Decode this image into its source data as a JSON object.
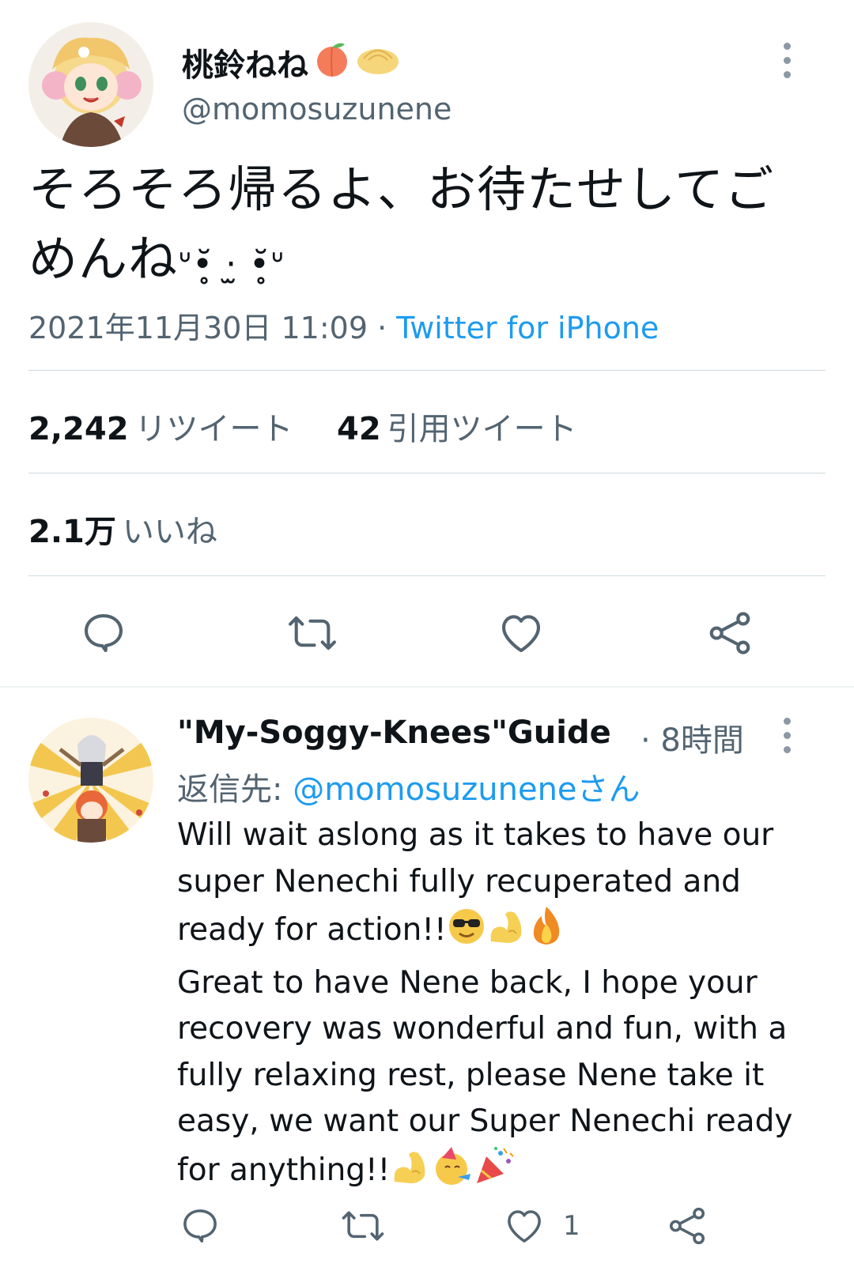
{
  "tweet": {
    "display_name": "桃鈴ねね",
    "name_emojis": [
      "peach-emoji",
      "bun-emoji"
    ],
    "handle": "@momosuzunene",
    "text_line1": "そろそろ帰るよ、お待たせしてご",
    "text_line2_prefix": "めんね",
    "text_kaomoji": "ᐡ•̥̆ ·̫ •̥̆ᐡ",
    "timestamp": "2021年11月30日 11:09",
    "separator": " · ",
    "source": "Twitter for iPhone",
    "retweets_count": "2,242",
    "retweets_label": "リツイート",
    "quotes_count": "42",
    "quotes_label": "引用ツイート",
    "likes_count": "2.1万",
    "likes_label": "いいね"
  },
  "actions": {
    "icons": [
      "reply-icon",
      "retweet-icon",
      "like-icon",
      "share-icon"
    ]
  },
  "reply": {
    "display_name": "\"My-Soggy-Knees\"Guide ...",
    "time": "· 8時間",
    "replying_prefix": "返信先:",
    "replying_to": "@momosuzuneneさん",
    "text_part1": "Will wait aslong as it takes to have our super Nenechi fully recuperated and ready for action!!",
    "text_part2": "Great to have Nene back, I hope your recovery was wonderful and fun, with a fully relaxing rest, please Nene take it easy, we want our Super Nenechi ready for anything!!",
    "emojis_part1": [
      "sunglasses-emoji",
      "flexed-biceps-emoji",
      "fire-emoji"
    ],
    "emojis_part2": [
      "flexed-biceps-emoji",
      "partying-face-emoji",
      "party-popper-emoji"
    ],
    "like_count": "1"
  },
  "colors": {
    "link": "#1d9bf0",
    "secondary_text": "#536471",
    "divider": "#cfd9de"
  }
}
